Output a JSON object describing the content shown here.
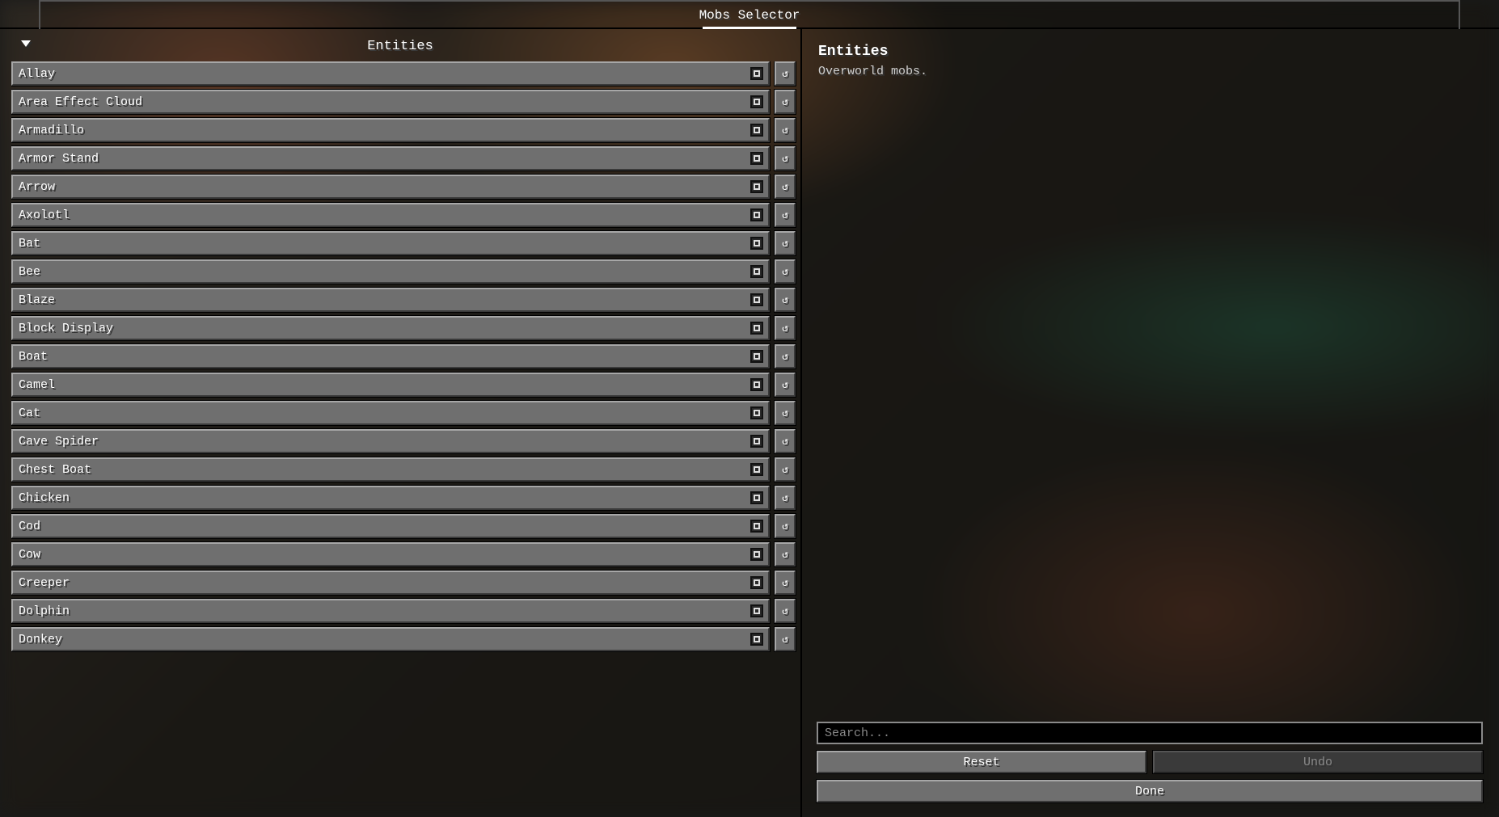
{
  "tabs": {
    "selector": "Mobs Selector"
  },
  "list": {
    "filter_icon": "filter",
    "title": "Entities",
    "items": [
      {
        "label": "Allay"
      },
      {
        "label": "Area Effect Cloud"
      },
      {
        "label": "Armadillo"
      },
      {
        "label": "Armor Stand"
      },
      {
        "label": "Arrow"
      },
      {
        "label": "Axolotl"
      },
      {
        "label": "Bat"
      },
      {
        "label": "Bee"
      },
      {
        "label": "Blaze"
      },
      {
        "label": "Block Display"
      },
      {
        "label": "Boat"
      },
      {
        "label": "Camel"
      },
      {
        "label": "Cat"
      },
      {
        "label": "Cave Spider"
      },
      {
        "label": "Chest Boat"
      },
      {
        "label": "Chicken"
      },
      {
        "label": "Cod"
      },
      {
        "label": "Cow"
      },
      {
        "label": "Creeper"
      },
      {
        "label": "Dolphin"
      },
      {
        "label": "Donkey"
      }
    ],
    "reset_icon": "↺"
  },
  "info": {
    "title": "Entities",
    "subtitle": "Overworld mobs."
  },
  "controls": {
    "search_placeholder": "Search...",
    "reset": "Reset",
    "undo": "Undo",
    "done": "Done"
  }
}
